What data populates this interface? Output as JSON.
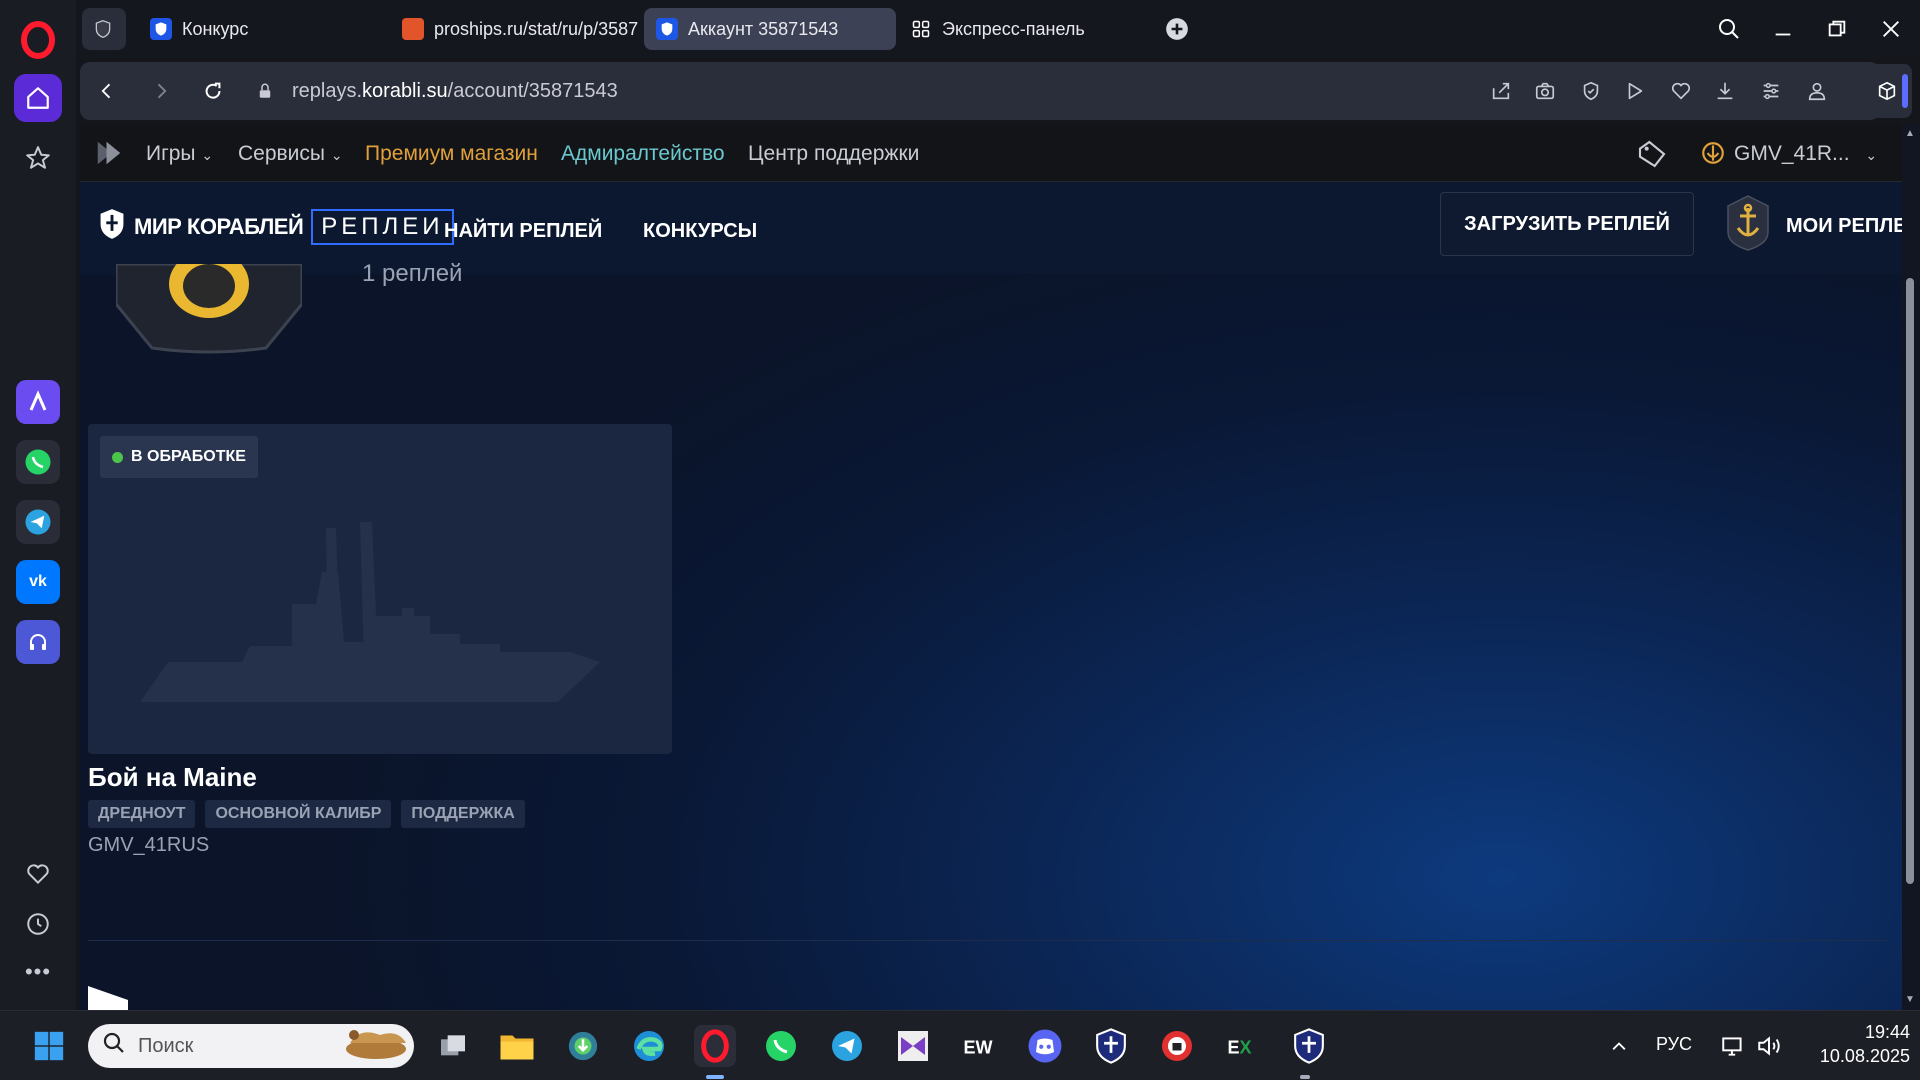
{
  "browser": {
    "tabs": [
      {
        "title": "Конкурс"
      },
      {
        "title": "proships.ru/stat/ru/p/3587"
      },
      {
        "title": "Аккаунт 35871543"
      },
      {
        "title": "Экспресс-панель"
      }
    ],
    "address": {
      "prefix": "replays.",
      "domain": "korabli.su",
      "path": "/account/35871543"
    },
    "colors": {
      "accent": "#5b2bd8",
      "active_tab": "#3d4155"
    }
  },
  "wg_bar": {
    "games": "Игры",
    "services": "Сервисы",
    "premium": "Премиум магазин",
    "admiralty": "Адмиралтейство",
    "support": "Центр поддержки",
    "user": "GMV_41R..."
  },
  "site_header": {
    "brand_name": "МИР КОРАБЛЕЙ",
    "brand_sub": "РЕПЛЕИ",
    "nav_find": "НАЙТИ РЕПЛЕЙ",
    "nav_contests": "КОНКУРСЫ",
    "upload": "ЗАГРУЗИТЬ РЕПЛЕЙ",
    "my_replays": "МОИ РЕПЛЕИ"
  },
  "profile": {
    "count_text": "1 реплей"
  },
  "replay_card": {
    "status": "В ОБРАБОТКЕ",
    "title": "Бой на Maine",
    "tags": [
      "ДРЕДНОУТ",
      "ОСНОВНОЙ КАЛИБР",
      "ПОДДЕРЖКА"
    ],
    "author": "GMV_41RUS",
    "status_color": "#4cc64a"
  },
  "taskbar": {
    "search_placeholder": "Поиск",
    "lang": "РУС",
    "time": "19:44",
    "date": "10.08.2025"
  }
}
